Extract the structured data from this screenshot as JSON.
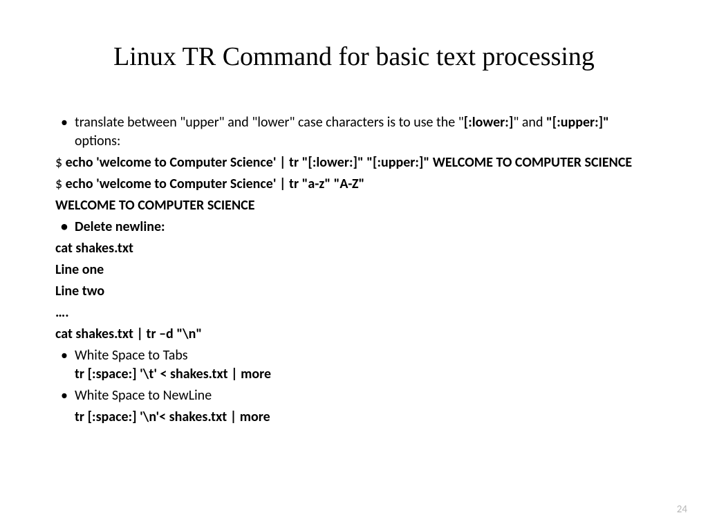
{
  "title": "Linux TR Command for basic text processing",
  "lines": {
    "l1a": "translate between \"upper\" and \"lower\" case characters is to use the \"",
    "l1b": "[:lower:]",
    "l1c": "\" and ",
    "l1d": "\"[:upper:]\"",
    "l1e": " options:",
    "l2a": "$ ",
    "l2b": "echo 'welcome to Computer Science' | tr \"[:lower:]\" \"[:upper:]\" WELCOME TO COMPUTER SCIENCE",
    "l3a": "$ ",
    "l3b": "echo 'welcome to Computer Science' | tr \"a-z\" \"A-Z\"",
    "l4": "WELCOME TO COMPUTER SCIENCE",
    "l5": "Delete newline:",
    "l6": "cat shakes.txt",
    "l7": "Line one",
    "l8": "Line two",
    "l9": "….",
    "l10": "cat shakes.txt | tr –d  \"\\n\"",
    "l11a": "White Space to Tabs",
    "l11b": "tr [:space:] '\\t' < shakes.txt | more",
    "l12": "White Space to NewLine",
    "l13": "tr [:space:] '\\n'< shakes.txt | more"
  },
  "pagenum": "24"
}
